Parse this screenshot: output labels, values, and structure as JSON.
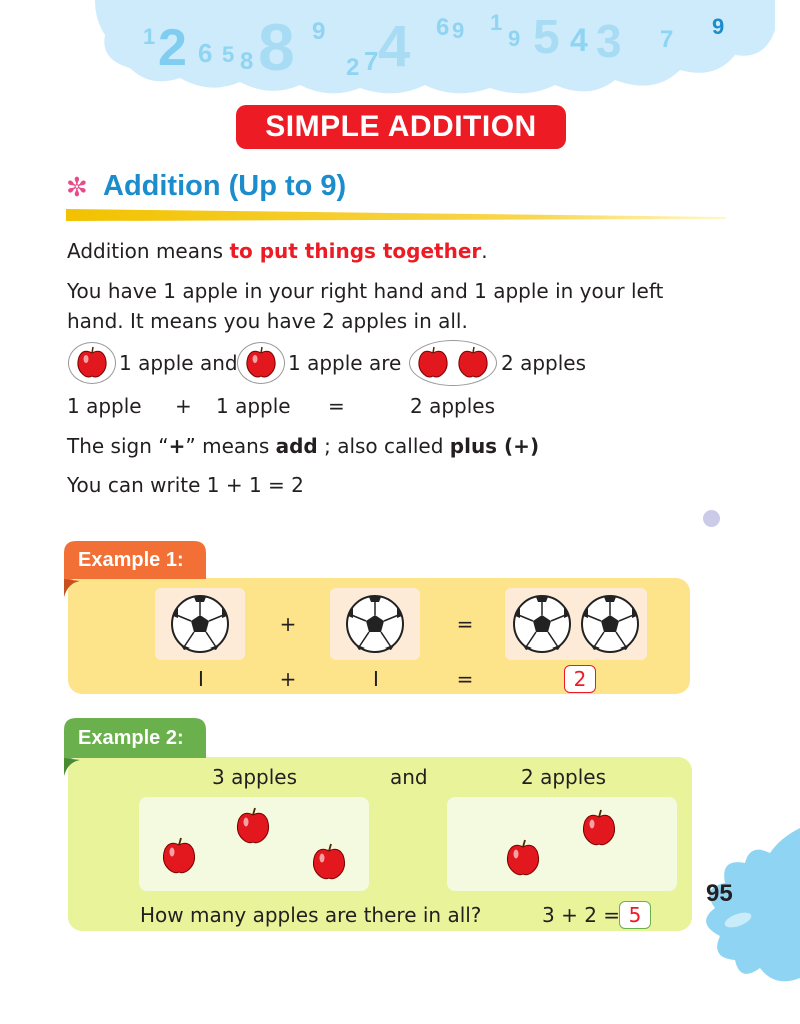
{
  "header": {
    "digits": [
      "1",
      "2",
      "6",
      "5",
      "8",
      "8",
      "9",
      "2",
      "7",
      "4",
      "6",
      "9",
      "1",
      "9",
      "5",
      "4",
      "3",
      "7",
      "9"
    ],
    "title": "SIMPLE ADDITION"
  },
  "section": {
    "icon": "flower-icon",
    "title": "Addition (Up to 9)"
  },
  "intro": {
    "line1_pre": "Addition means ",
    "line1_red": "to put things together",
    "line1_post": ".",
    "line2": "You have 1 apple in your right hand and 1 apple in your left",
    "line3": "hand. It means you have 2 apples in all.",
    "apples_row": {
      "t1": "1 apple and",
      "t2": "1 apple are",
      "t3": "2 apples"
    },
    "words_row": {
      "a": "1 apple",
      "plus": "+",
      "b": "1 apple",
      "eq": "=",
      "c": "2 apples"
    },
    "sign_pre": "The sign “",
    "sign_plus": "+",
    "sign_mid": "” means ",
    "sign_add": "add",
    "sign_mid2": " ; also called ",
    "sign_plus_word": "plus (+)",
    "write": "You can write 1 + 1 = 2"
  },
  "example1": {
    "label": "Example 1:",
    "plus": "+",
    "eq": "=",
    "n1": "I",
    "n2": "I",
    "answer": "2"
  },
  "example2": {
    "label": "Example 2:",
    "left_label": "3 apples",
    "and": "and",
    "right_label": "2 apples",
    "question": "How many apples are there in all?",
    "equation": "3 + 2 =",
    "answer": "5"
  },
  "page_number": "95",
  "colors": {
    "title_red": "#ed1c24",
    "section_blue": "#1b8ccc",
    "example1_tab": "#f26f36",
    "example1_panel": "#fde48a",
    "example2_tab": "#6ab04c",
    "example2_panel": "#e8f39a",
    "cloud_blue": "#bfe6f9"
  }
}
